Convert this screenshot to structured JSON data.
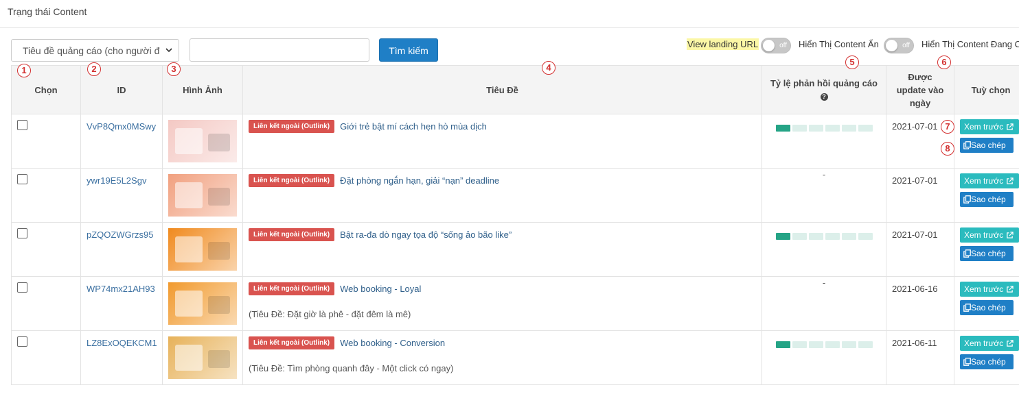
{
  "page": {
    "title": "Trạng thái Content"
  },
  "toolbar": {
    "filter_select_value": "Tiêu đề quảng cáo (cho người đ",
    "search_value": "",
    "search_button": "Tìm kiếm",
    "toggles": [
      {
        "label": "View landing URL",
        "state": "off"
      },
      {
        "label": "Hiển Thị Content Ẩn",
        "state": "off"
      },
      {
        "label": "Hiển Thị Content Đang Chạy",
        "state": "off"
      }
    ]
  },
  "table": {
    "headers": {
      "select": "Chọn",
      "id": "ID",
      "image": "Hình Ảnh",
      "title": "Tiêu Đề",
      "response_rate": "Tỷ lệ phản hồi quảng cáo",
      "updated": "Được update vào ngày",
      "options": "Tuỳ chọn"
    },
    "badge_label": "Liên kết ngoài (Outlink)",
    "preview_label": "Xem trước",
    "copy_label": "Sao chép",
    "rows": [
      {
        "id": "VvP8Qmx0MSwy",
        "title": "Giới trẻ bật mí cách hẹn hò mùa dịch",
        "subtitle": "",
        "rate_level": 1,
        "rate_text": "",
        "date": "2021-07-01",
        "thumb_bg": "#f4c9c4"
      },
      {
        "id": "ywr19E5L2Sgv",
        "title": "Đặt phòng ngắn hạn, giải “nạn” deadline",
        "subtitle": "",
        "rate_level": null,
        "rate_text": "-",
        "date": "2021-07-01",
        "thumb_bg": "#f1a07f"
      },
      {
        "id": "pZQOZWGrzs95",
        "title": "Bật ra-đa dò ngay tọa độ “sống ảo bão like”",
        "subtitle": "",
        "rate_level": 1,
        "rate_text": "",
        "date": "2021-07-01",
        "thumb_bg": "#f08a1e"
      },
      {
        "id": "WP74mx21AH93",
        "title": "Web booking - Loyal",
        "subtitle": "(Tiêu Đề: Đặt giờ là phê - đặt đêm là mê)",
        "rate_level": null,
        "rate_text": "-",
        "date": "2021-06-16",
        "thumb_bg": "#f19a2e"
      },
      {
        "id": "LZ8ExOQEKCM1",
        "title": "Web booking - Conversion",
        "subtitle": "(Tiêu Đề: Tìm phòng quanh đây - Một click có ngay)",
        "rate_level": 1,
        "rate_text": "",
        "date": "2021-06-11",
        "thumb_bg": "#e7b25a"
      }
    ]
  },
  "markers": [
    "1",
    "2",
    "3",
    "4",
    "5",
    "6",
    "7",
    "8"
  ],
  "colors": {
    "primary": "#1f7fc6",
    "preview": "#2bbbbe",
    "badge": "#d9534f",
    "bar_on": "#25a486",
    "bar_off": "#dcefea"
  }
}
